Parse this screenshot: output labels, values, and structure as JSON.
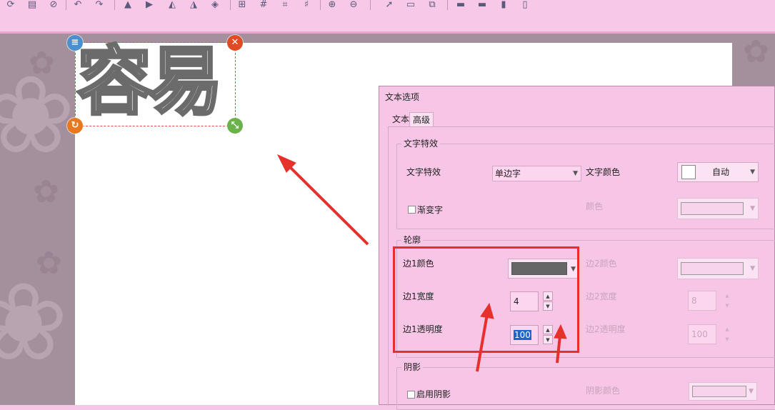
{
  "canvas": {
    "text_object": {
      "content": "容易"
    }
  },
  "dialog": {
    "title": "文本选项",
    "tabs": [
      {
        "label": "文本",
        "active": false
      },
      {
        "label": "高级",
        "active": true
      }
    ],
    "effects_group": {
      "title": "文字特效",
      "effect_label": "文字特效",
      "effect_value": "单边字",
      "text_color_label": "文字颜色",
      "text_color_value": "自动",
      "gradient_label": "渐变字",
      "gradient_checked": false,
      "color_label": "颜色"
    },
    "outline_group": {
      "title": "轮廓",
      "edge1_color_label": "边1颜色",
      "edge1_color": "#666666",
      "edge1_width_label": "边1宽度",
      "edge1_width_value": "4",
      "edge1_opacity_label": "边1透明度",
      "edge1_opacity_value": "100",
      "edge2_color_label": "边2颜色",
      "edge2_width_label": "边2宽度",
      "edge2_width_value": "8",
      "edge2_opacity_label": "边2透明度",
      "edge2_opacity_value": "100"
    },
    "shadow_group": {
      "title": "阴影",
      "enable_label": "启用阴影",
      "enable_checked": false,
      "shadow_color_label": "阴影颜色"
    }
  },
  "colors": {
    "window_bg": "#f7c6e6",
    "annotation_red": "#e5302c",
    "selection_blue": "#1e64c8"
  }
}
